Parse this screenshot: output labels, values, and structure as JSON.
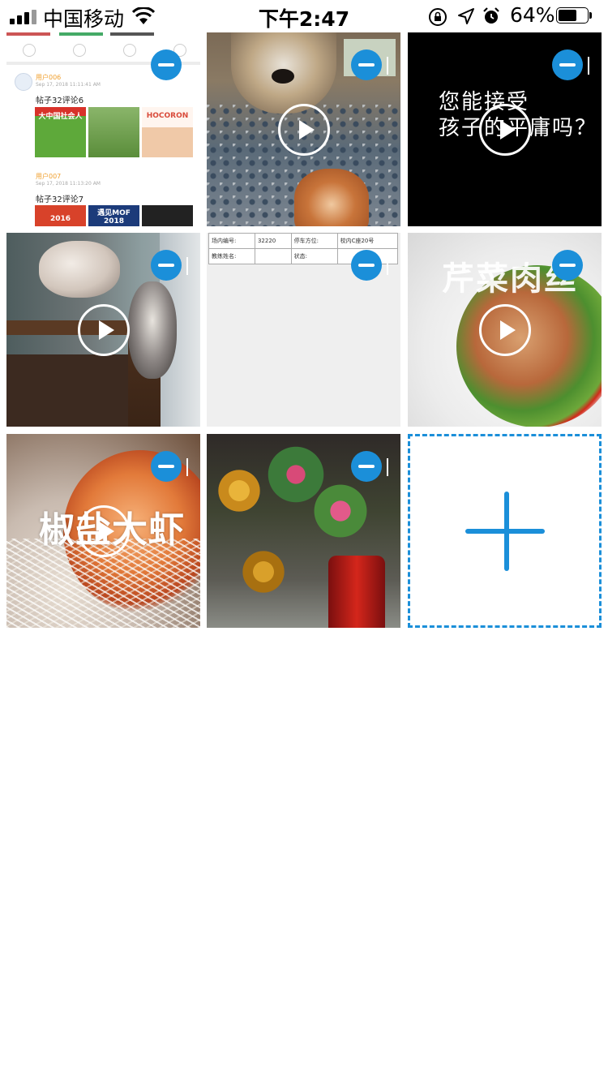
{
  "status_bar": {
    "carrier": "中国移动",
    "time": "下午2:47",
    "battery_percent": "64%",
    "battery_level": 0.64
  },
  "tiles": [
    {
      "kind": "image",
      "feed": {
        "posts": [
          {
            "user": "用户006",
            "date": "Sep 17, 2018 11:11:41 AM",
            "title": "帖子32评论6",
            "thumbs": [
              "大中国社会人",
              "",
              "HOCORON"
            ]
          },
          {
            "user": "用户007",
            "date": "Sep 17, 2018 11:13:20 AM",
            "title": "帖子32评论7",
            "thumbs": [
              "2016",
              "遇见MOF 2018",
              ""
            ]
          }
        ]
      }
    },
    {
      "kind": "video"
    },
    {
      "kind": "video",
      "caption_lines": [
        "您能接受",
        "孩子的平庸吗？"
      ]
    },
    {
      "kind": "video"
    },
    {
      "kind": "image",
      "form": {
        "rows": [
          [
            "场内编号:",
            "32220",
            "停车方位:",
            "校内C座20号"
          ],
          [
            "教练姓名:",
            "",
            "状态:",
            ""
          ]
        ]
      }
    },
    {
      "kind": "video",
      "caption": "芹菜肉丝"
    },
    {
      "kind": "video",
      "caption": "椒盐大虾"
    },
    {
      "kind": "image"
    }
  ],
  "add_button": {
    "icon": "plus-icon"
  },
  "colors": {
    "accent": "#1b8fd9",
    "background": "#ffffff"
  }
}
